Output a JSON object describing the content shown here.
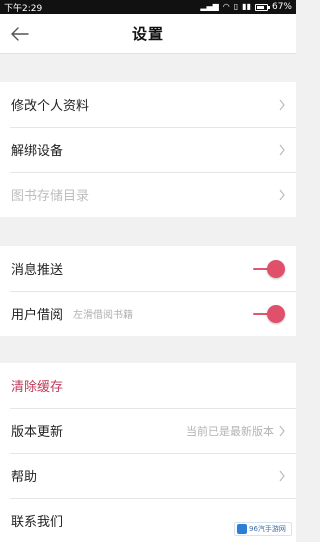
{
  "status_bar": {
    "time": "下午2:29",
    "battery": "67%",
    "battery_level": 0.67
  },
  "header": {
    "title": "设置"
  },
  "account": {
    "items": [
      {
        "label": "修改个人资料"
      },
      {
        "label": "解绑设备"
      },
      {
        "label": "图书存储目录"
      }
    ]
  },
  "notifications": {
    "push_label": "消息推送",
    "push_on": true,
    "borrow_label": "用户借阅",
    "borrow_sub": "左滑借阅书籍",
    "borrow_on": true
  },
  "other": {
    "clear_cache": "清除缓存",
    "update_label": "版本更新",
    "update_value": "当前已是最新版本",
    "help": "帮助",
    "contact": "联系我们"
  },
  "watermark": {
    "text": "96汽手游网"
  },
  "colors": {
    "accent": "#e0506b",
    "background": "#f1f1f1"
  }
}
